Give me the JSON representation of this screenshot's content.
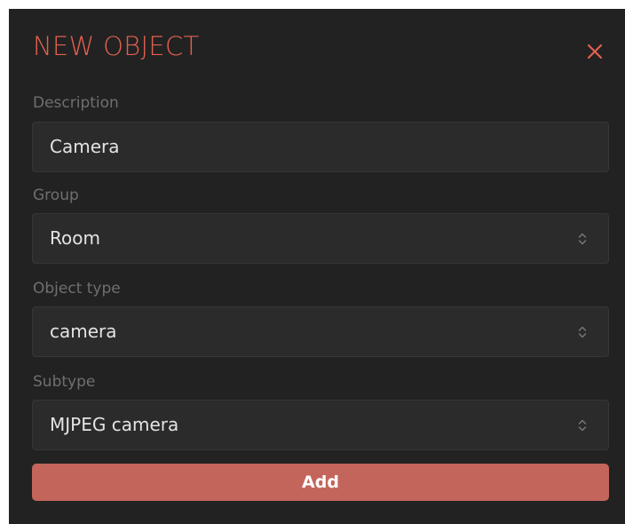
{
  "dialog": {
    "title": "NEW OBJECT",
    "accent_color": "#e2604f",
    "close_icon": "close-icon"
  },
  "form": {
    "description": {
      "label": "Description",
      "value": "Camera"
    },
    "group": {
      "label": "Group",
      "selected": "Room",
      "icon": "select-chevrons-icon"
    },
    "object_type": {
      "label": "Object type",
      "selected": "camera",
      "icon": "select-chevrons-icon"
    },
    "subtype": {
      "label": "Subtype",
      "selected": "MJPEG camera",
      "icon": "select-chevrons-icon"
    }
  },
  "actions": {
    "add_label": "Add",
    "add_color": "#c4655c"
  }
}
